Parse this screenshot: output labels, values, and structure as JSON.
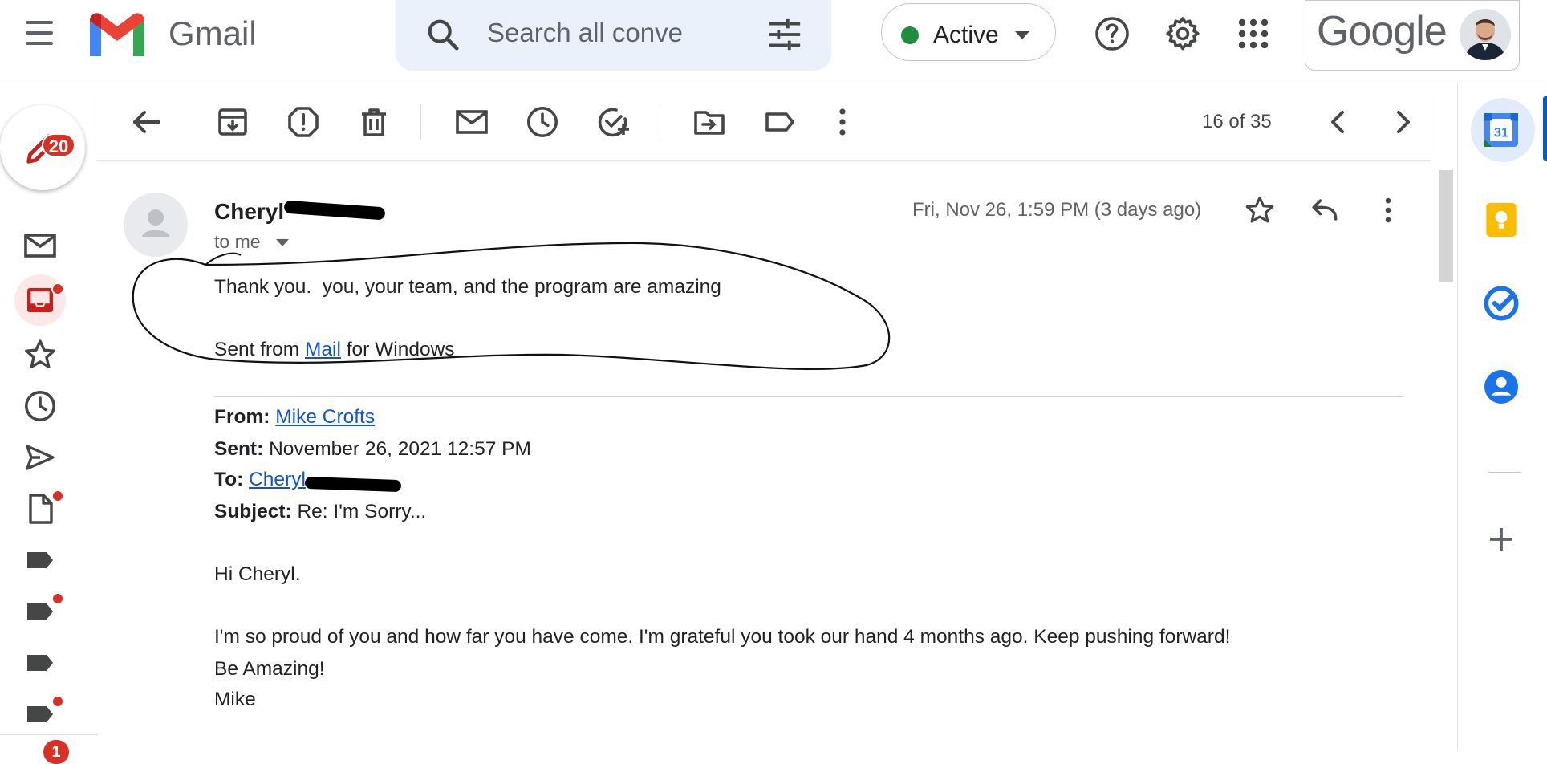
{
  "header": {
    "brand": "Gmail",
    "search_placeholder": "Search all conve",
    "status": "Active",
    "account_brand": "Google"
  },
  "leftnav": {
    "mail_badge": "20",
    "bottom_badge": "1"
  },
  "toolbar": {
    "pager": "16 of 35"
  },
  "message": {
    "sender": "Cheryl",
    "recipient_label": "to me",
    "date": "Fri, Nov 26, 1:59 PM (3 days ago)",
    "line1": "Thank you.  you, your team, and the program are amazing",
    "sent_from_prefix": "Sent from ",
    "sent_from_link": "Mail",
    "sent_from_suffix": " for Windows",
    "quoted": {
      "from_label": "From:",
      "from_value": "Mike Crofts",
      "sent_label": "Sent:",
      "sent_value": "November 26, 2021 12:57 PM",
      "to_label": "To:",
      "to_value": "Cheryl",
      "subject_label": "Subject:",
      "subject_value": "Re: I'm Sorry...",
      "greeting": "Hi Cheryl.",
      "paragraph": "I'm so proud of you and how far you have come. I'm grateful you took our hand 4 months ago. Keep pushing forward!",
      "closing": "Be Amazing!",
      "signature": "Mike"
    }
  },
  "sidepanel": {
    "calendar_day": "31"
  },
  "colors": {
    "accent_red": "#d93025",
    "link_blue": "#1155cc",
    "status_green": "#1e8e3e",
    "search_bg": "#eaf1fb"
  }
}
